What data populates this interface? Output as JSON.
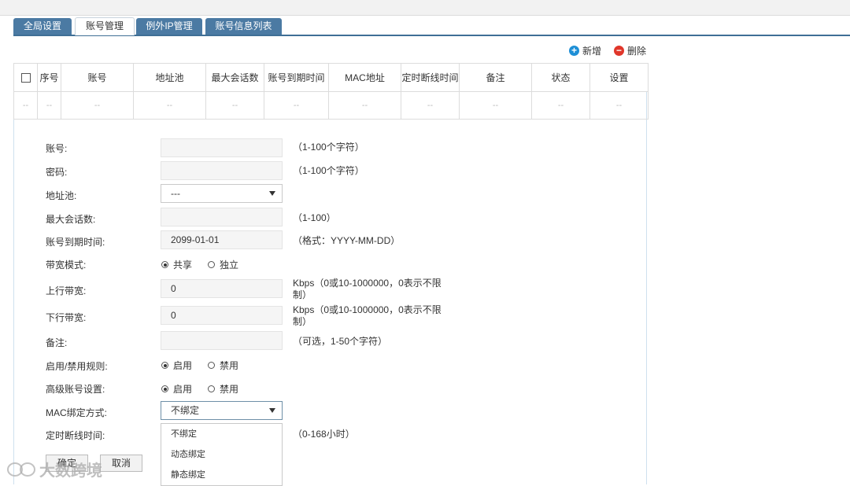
{
  "tabs": [
    "全局设置",
    "账号管理",
    "例外IP管理",
    "账号信息列表"
  ],
  "actions": {
    "add": "新增",
    "delete": "删除",
    "add_color": "#1e8fd6",
    "delete_color": "#e0362a"
  },
  "table": {
    "headers": [
      "序号",
      "账号",
      "地址池",
      "最大会话数",
      "账号到期时间",
      "MAC地址",
      "定时断线时间",
      "备注",
      "状态",
      "设置"
    ],
    "row": [
      "--",
      "--",
      "--",
      "--",
      "--",
      "--",
      "--",
      "--",
      "--",
      "--",
      "--"
    ]
  },
  "form": {
    "account": {
      "label": "账号:",
      "hint": "（1-100个字符）"
    },
    "password": {
      "label": "密码:",
      "hint": "（1-100个字符）"
    },
    "pool": {
      "label": "地址池:",
      "value": "---"
    },
    "max_sessions": {
      "label": "最大会话数:",
      "hint": "（1-100）"
    },
    "expire": {
      "label": "账号到期时间:",
      "value": "2099-01-01",
      "hint": "（格式：YYYY-MM-DD）"
    },
    "bw_mode": {
      "label": "带宽模式:",
      "opt1": "共享",
      "opt2": "独立"
    },
    "up_bw": {
      "label": "上行带宽:",
      "value": "0",
      "hint1": "Kbps（0或10-1000000，0表示不限",
      "hint2": "制）"
    },
    "down_bw": {
      "label": "下行带宽:",
      "value": "0",
      "hint1": "Kbps（0或10-1000000，0表示不限",
      "hint2": "制）"
    },
    "remark": {
      "label": "备注:",
      "hint": "（可选，1-50个字符）"
    },
    "rule": {
      "label": "启用/禁用规则:",
      "opt1": "启用",
      "opt2": "禁用"
    },
    "advanced": {
      "label": "高级账号设置:",
      "opt1": "启用",
      "opt2": "禁用"
    },
    "mac_bind": {
      "label": "MAC绑定方式:",
      "value": "不绑定",
      "options": [
        "不绑定",
        "动态绑定",
        "静态绑定"
      ]
    },
    "timeout": {
      "label": "定时断线时间:",
      "hint": "（0-168小时）"
    }
  },
  "buttons": {
    "ok": "确定",
    "cancel": "取消"
  },
  "watermark": "大数跨境"
}
